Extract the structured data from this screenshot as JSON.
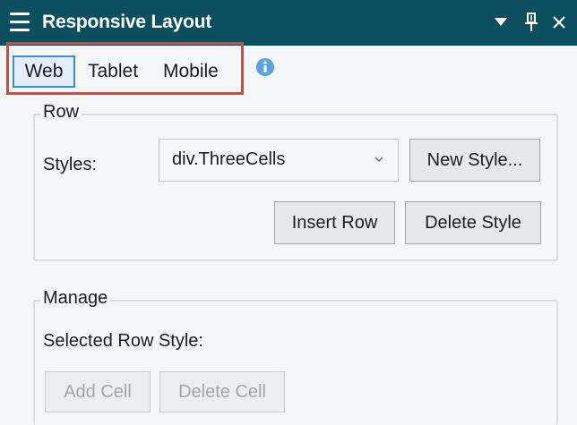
{
  "titlebar": {
    "title": "Responsive Layout",
    "menu_icon": "hamburger-icon",
    "dropdown_icon": "triangle-down-icon",
    "pin_icon": "pin-icon",
    "close_icon": "close-icon",
    "background": "#0c4f5e"
  },
  "tabs": {
    "items": [
      {
        "label": "Web",
        "selected": true
      },
      {
        "label": "Tablet",
        "selected": false
      },
      {
        "label": "Mobile",
        "selected": false
      }
    ],
    "info_icon": "info-icon",
    "highlight_color": "#e14434",
    "selected_border_color": "#3a8ed8"
  },
  "row_group": {
    "label": "Row",
    "styles_label": "Styles:",
    "styles_value": "div.ThreeCells",
    "new_style_label": "New Style...",
    "insert_row_label": "Insert Row",
    "delete_style_label": "Delete Style"
  },
  "manage_group": {
    "label": "Manage",
    "selected_row_style_label": "Selected Row Style:",
    "add_cell_label": "Add Cell",
    "delete_cell_label": "Delete Cell"
  }
}
